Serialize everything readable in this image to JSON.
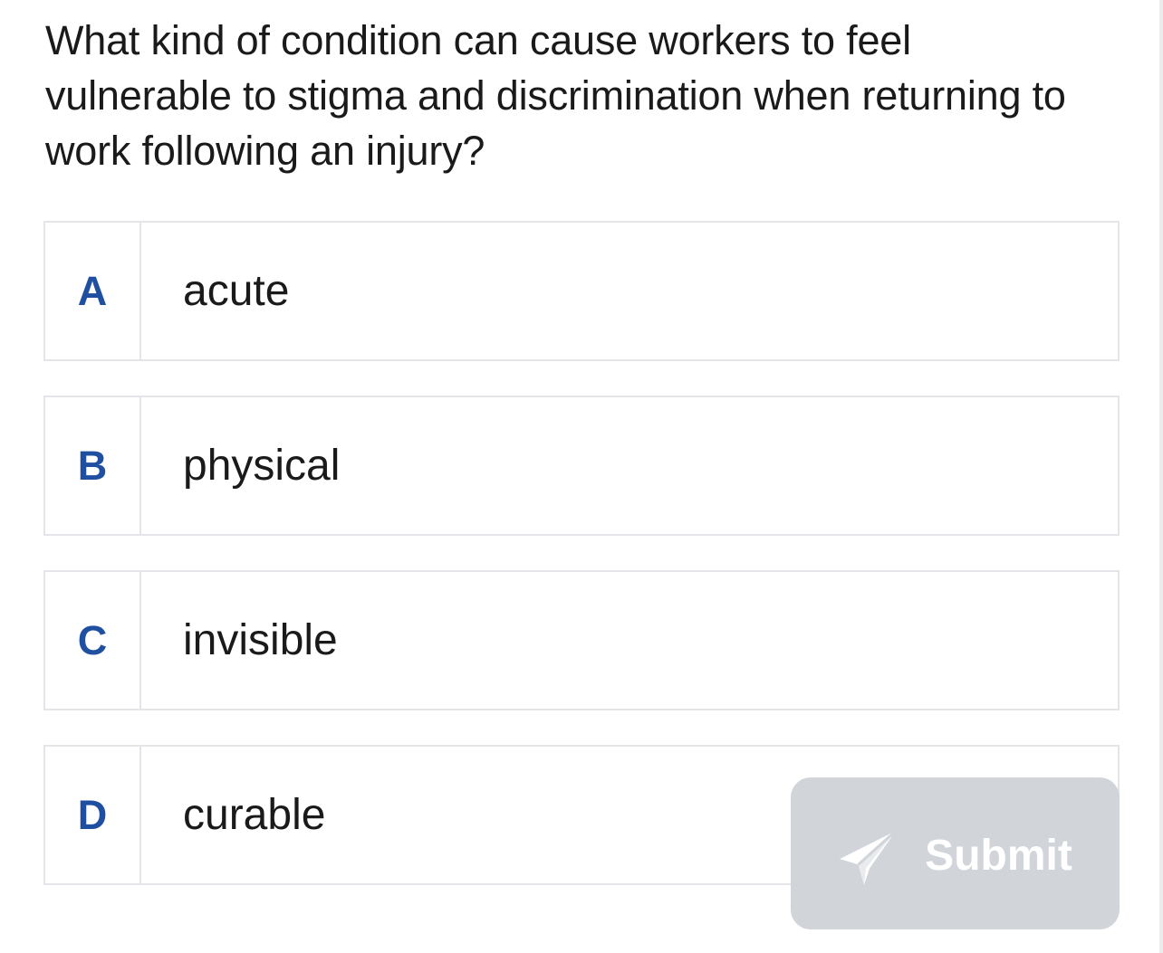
{
  "question": {
    "text": "What kind of condition can cause workers to feel vulnerable to stigma and discrimination when returning to work following an injury?"
  },
  "options": [
    {
      "letter": "A",
      "text": "acute"
    },
    {
      "letter": "B",
      "text": "physical"
    },
    {
      "letter": "C",
      "text": "invisible"
    },
    {
      "letter": "D",
      "text": "curable"
    }
  ],
  "submit": {
    "label": "Submit",
    "icon": "send-icon",
    "background": "#d1d4d9",
    "text_color": "#ffffff",
    "state": "disabled"
  },
  "colors": {
    "letter": "#1f4fa0",
    "border": "#e3e5e8",
    "text": "#1a1a1a"
  }
}
